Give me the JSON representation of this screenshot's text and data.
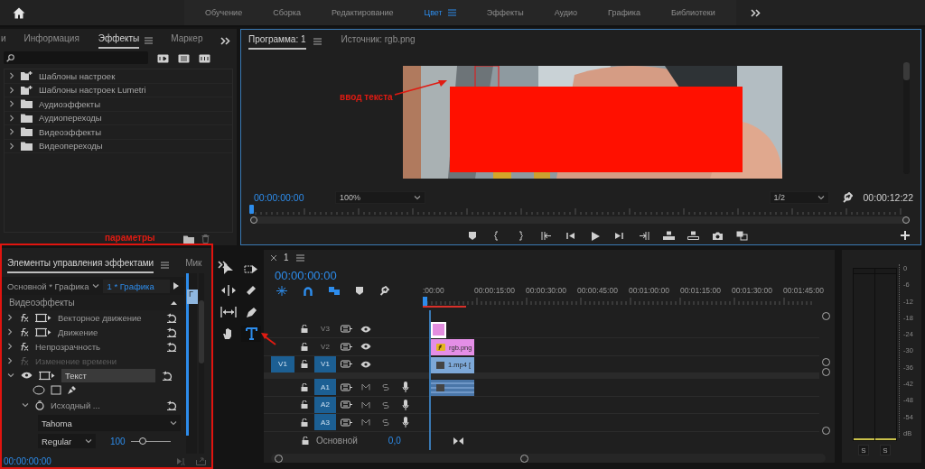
{
  "header": {
    "workspaces": [
      {
        "label": "Обучение",
        "selected": false
      },
      {
        "label": "Сборка",
        "selected": false
      },
      {
        "label": "Редактирование",
        "selected": false
      },
      {
        "label": "Цвет",
        "selected": true
      },
      {
        "label": "Эффекты",
        "selected": false
      },
      {
        "label": "Аудио",
        "selected": false
      },
      {
        "label": "Графика",
        "selected": false
      },
      {
        "label": "Библиотеки",
        "selected": false
      }
    ]
  },
  "effects_panel": {
    "tabs": [
      {
        "label": "и",
        "selected": false
      },
      {
        "label": "Информация",
        "selected": false
      },
      {
        "label": "Эффекты",
        "selected": true
      },
      {
        "label": "Маркер",
        "selected": false
      }
    ],
    "items": [
      {
        "label": "Шаблоны настроек",
        "kind": "preset"
      },
      {
        "label": "Шаблоны настроек Lumetri",
        "kind": "preset"
      },
      {
        "label": "Аудиоэффекты",
        "kind": "folder"
      },
      {
        "label": "Аудиопереходы",
        "kind": "folder"
      },
      {
        "label": "Видеоэффекты",
        "kind": "folder"
      },
      {
        "label": "Видеопереходы",
        "kind": "folder"
      }
    ]
  },
  "program_monitor": {
    "tabs": [
      {
        "label": "Программа: 1",
        "selected": true
      },
      {
        "label": "Источник: rgb.png",
        "selected": false
      }
    ],
    "timecode": "00:00:00:00",
    "zoom": "100%",
    "resolution": "1/2",
    "duration": "00:00:12:22"
  },
  "effect_controls": {
    "tabs": [
      {
        "label": "Элементы управления эффектами",
        "selected": true
      },
      {
        "label": "Мик",
        "selected": false
      }
    ],
    "source": "Основной * Графика",
    "clip": "1 * Графика",
    "clip_marker": "Г",
    "section": "Видеоэффекты",
    "effects": [
      {
        "label": "Векторное движение",
        "kind": "motion",
        "expanded": false,
        "enabled": true
      },
      {
        "label": "Движение",
        "kind": "motion",
        "expanded": false,
        "enabled": true
      },
      {
        "label": "Непрозрачность",
        "kind": "fx",
        "expanded": false,
        "enabled": true
      },
      {
        "label": "Изменение времени",
        "kind": "fx",
        "expanded": false,
        "enabled": false
      },
      {
        "label": "Текст",
        "kind": "text",
        "expanded": true,
        "enabled": true
      }
    ],
    "source_text": {
      "label": "Исходный ...",
      "font": "Tahoma",
      "style": "Regular",
      "size": "100",
      "level": 0.25
    },
    "timecode": "00:00:00:00"
  },
  "tools": [
    {
      "kind": "select",
      "selected": false
    },
    {
      "kind": "track-select",
      "selected": false
    },
    {
      "kind": "ripple",
      "selected": false
    },
    {
      "kind": "razor",
      "selected": false
    },
    {
      "kind": "slip",
      "selected": false
    },
    {
      "kind": "pen",
      "selected": false
    },
    {
      "kind": "hand",
      "selected": false
    },
    {
      "kind": "type",
      "selected": true
    }
  ],
  "timeline": {
    "sequence": "1",
    "timecode": "00:00:00:00",
    "ruler": [
      ":00:00",
      "00:00:15:00",
      "00:00:30:00",
      "00:00:45:00",
      "00:01:00:00",
      "00:01:15:00",
      "00:01:30:00",
      "00:01:45:00"
    ],
    "video_tracks": [
      {
        "name": "V3",
        "targeted": false,
        "clip": {
          "kind": "graphic"
        }
      },
      {
        "name": "V2",
        "targeted": false,
        "clip": {
          "label": "rgb.png"
        }
      },
      {
        "name": "V1",
        "targeted": true,
        "source": "V1",
        "clip": {
          "kind": "video",
          "label": "1.mp4 ["
        }
      }
    ],
    "audio_tracks": [
      {
        "name": "A1",
        "targeted": true,
        "clip": {
          "kind": "audio"
        }
      },
      {
        "name": "A2",
        "targeted": true
      },
      {
        "name": "A3",
        "targeted": true
      }
    ],
    "master": {
      "label": "Основной",
      "value": "0,0"
    }
  },
  "audio_meter": {
    "scale": [
      "0",
      "-6",
      "-12",
      "-18",
      "-24",
      "-30",
      "-36",
      "-42",
      "-48",
      "-54",
      "dB"
    ],
    "solo_buttons": [
      "S",
      "S"
    ]
  },
  "annotations": [
    {
      "kind": "arrow-label",
      "text": "ввод текста"
    },
    {
      "kind": "label",
      "text": "параметры"
    },
    {
      "kind": "arrow"
    },
    {
      "kind": "frame"
    }
  ]
}
